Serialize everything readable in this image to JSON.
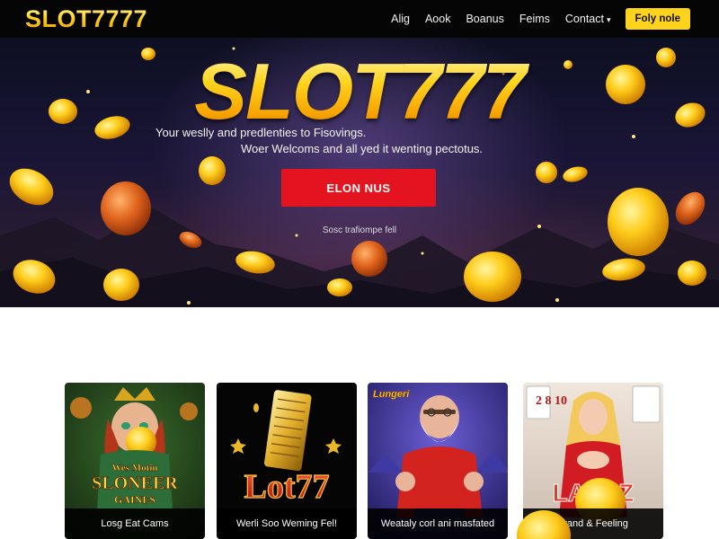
{
  "nav": {
    "logo": "SLOT7777",
    "links": [
      {
        "label": "Alig"
      },
      {
        "label": "Aook"
      },
      {
        "label": "Boanus"
      },
      {
        "label": "Feims"
      },
      {
        "label": "Contact",
        "caret": "▾"
      }
    ],
    "cta_label": "Foly nole"
  },
  "hero": {
    "title": "SLOT777",
    "subtitle_line1": "Your weslly and predlenties to Fisovings.",
    "subtitle_line2": "Woer Welcoms and all yed it wenting pectotus.",
    "button_label": "ELON NUS",
    "caption": "Sosc trafiompe fell"
  },
  "games": [
    {
      "label": "Losg Eat Cams",
      "art_text_top": "Wes Motin",
      "art_text_main": "SLONEER",
      "art_text_bottom": "GAINES"
    },
    {
      "label": "Werli Soo Weming Fel!",
      "art_text_main": "Lot77"
    },
    {
      "label": "Weataly corl ani masfated",
      "art_text_top": "Lungeri"
    },
    {
      "label": "Lrand & Feeling",
      "art_text_main": "LATOZ",
      "art_numbers": "2 8 10"
    }
  ],
  "colors": {
    "nav_bg": "#050505",
    "gold": "#ffd21c",
    "hero_button": "#e3141f",
    "card_label_bg": "#000000"
  }
}
